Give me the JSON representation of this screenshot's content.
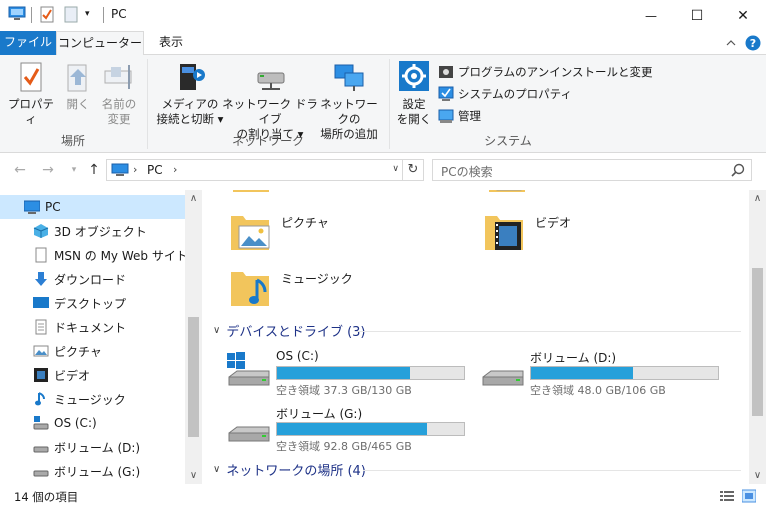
{
  "window": {
    "title": "PC",
    "minimize_glyph": "—",
    "maximize_glyph": "☐",
    "close_glyph": "✕"
  },
  "ribbon_tabs": {
    "file": "ファイル",
    "computer": "コンピューター",
    "view": "表示"
  },
  "ribbon": {
    "groups": {
      "location": {
        "label": "場所",
        "buttons": [
          {
            "label": "プロパティ",
            "icon": "properties-checkmark-icon"
          },
          {
            "label": "開く",
            "icon": "open-icon",
            "disabled": true
          },
          {
            "label": "名前の\n変更",
            "icon": "rename-icon",
            "disabled": true
          }
        ]
      },
      "network": {
        "label": "ネットワーク",
        "buttons": [
          {
            "label": "メディアの\n接続と切断 ▾",
            "icon": "media-server-icon"
          },
          {
            "label": "ネットワーク ドライブ\nの割り当て ▾",
            "icon": "map-network-drive-icon"
          },
          {
            "label": "ネットワークの\n場所の追加",
            "icon": "add-network-location-icon"
          }
        ]
      },
      "system": {
        "label": "システム",
        "big_button": {
          "label": "設定\nを開く",
          "icon": "settings-gear-icon"
        },
        "small_buttons": [
          {
            "label": "プログラムのアンインストールと変更",
            "icon": "uninstall-program-icon"
          },
          {
            "label": "システムのプロパティ",
            "icon": "system-properties-icon"
          },
          {
            "label": "管理",
            "icon": "manage-icon"
          }
        ]
      }
    }
  },
  "address": {
    "path_root": "PC",
    "search_placeholder": "PCの検索"
  },
  "sidebar": {
    "items": [
      {
        "label": "PC",
        "icon": "pc-icon",
        "selected": true
      },
      {
        "label": "3D オブジェクト",
        "icon": "3d-objects-icon"
      },
      {
        "label": "MSN の My Web サイト",
        "icon": "web-page-icon"
      },
      {
        "label": "ダウンロード",
        "icon": "download-arrow-icon"
      },
      {
        "label": "デスクトップ",
        "icon": "desktop-icon"
      },
      {
        "label": "ドキュメント",
        "icon": "document-icon"
      },
      {
        "label": "ピクチャ",
        "icon": "pictures-icon"
      },
      {
        "label": "ビデオ",
        "icon": "video-icon"
      },
      {
        "label": "ミュージック",
        "icon": "music-note-icon"
      },
      {
        "label": "OS (C:)",
        "icon": "drive-c-icon"
      },
      {
        "label": "ボリューム (D:)",
        "icon": "drive-icon"
      },
      {
        "label": "ボリューム (G:)",
        "icon": "drive-icon"
      }
    ]
  },
  "content": {
    "folders": [
      {
        "label": "ピクチャ",
        "icon": "pictures-folder-icon"
      },
      {
        "label": "ビデオ",
        "icon": "videos-folder-icon"
      },
      {
        "label": "ミュージック",
        "icon": "music-folder-icon"
      }
    ],
    "devices_header": "デバイスとドライブ (3)",
    "network_header": "ネットワークの場所 (4)",
    "drives": [
      {
        "name": "OS (C:)",
        "free_text": "空き領域 37.3 GB/130 GB",
        "used_fraction": 0.713
      },
      {
        "name": "ボリューム (D:)",
        "free_text": "空き領域 48.0 GB/106 GB",
        "used_fraction": 0.547
      },
      {
        "name": "ボリューム (G:)",
        "free_text": "空き領域 92.8 GB/465 GB",
        "used_fraction": 0.8
      }
    ]
  },
  "statusbar": {
    "item_count": "14 個の項目"
  },
  "colors": {
    "accent": "#1979ca",
    "bar_fill": "#26a0da",
    "header_text": "#1e3287",
    "selection": "#cce8ff"
  }
}
